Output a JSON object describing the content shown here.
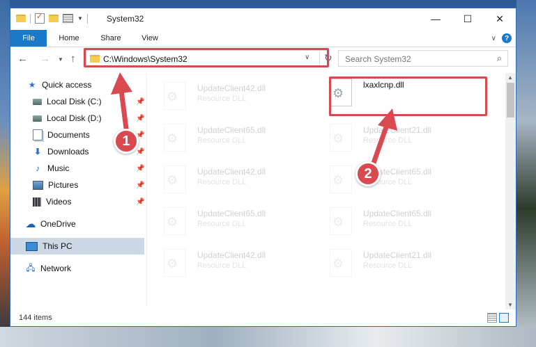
{
  "window": {
    "title": "System32",
    "controls": {
      "minimize": "—",
      "maximize": "☐",
      "close": "✕"
    }
  },
  "ribbon": {
    "tabs": {
      "file": "File",
      "home": "Home",
      "share": "Share",
      "view": "View"
    },
    "help": "?"
  },
  "navigation": {
    "address": "C:\\Windows\\System32",
    "search_placeholder": "Search System32"
  },
  "sidebar": {
    "items": [
      {
        "label": "Quick access",
        "icon": "star-icon",
        "pinned": false
      },
      {
        "label": "Local Disk (C:)",
        "icon": "drive-icon",
        "pinned": true
      },
      {
        "label": "Local Disk (D:)",
        "icon": "drive-icon",
        "pinned": true
      },
      {
        "label": "Documents",
        "icon": "documents-icon",
        "pinned": true
      },
      {
        "label": "Downloads",
        "icon": "download-icon",
        "pinned": true
      },
      {
        "label": "Music",
        "icon": "music-icon",
        "pinned": true
      },
      {
        "label": "Pictures",
        "icon": "pictures-icon",
        "pinned": true
      },
      {
        "label": "Videos",
        "icon": "videos-icon",
        "pinned": true
      },
      {
        "label": "OneDrive",
        "icon": "onedrive-icon",
        "pinned": false
      },
      {
        "label": "This PC",
        "icon": "pc-icon",
        "pinned": false,
        "selected": true
      },
      {
        "label": "Network",
        "icon": "network-icon",
        "pinned": false
      }
    ]
  },
  "files": [
    {
      "name": "UpdateClient42.dll",
      "type": "Resource DLL",
      "faded": true
    },
    {
      "name": "lxaxlcnp.dll",
      "type": "",
      "faded": false,
      "highlighted": true
    },
    {
      "name": "UpdateClient65.dll",
      "type": "Resource DLL",
      "faded": true
    },
    {
      "name": "UpdateClient21.dll",
      "type": "Resource DLL",
      "faded": true
    },
    {
      "name": "UpdateClient42.dll",
      "type": "Resource DLL",
      "faded": true
    },
    {
      "name": "UpdateClient65.dll",
      "type": "Resource DLL",
      "faded": true
    },
    {
      "name": "UpdateClient65.dll",
      "type": "Resource DLL",
      "faded": true
    },
    {
      "name": "UpdateClient65.dll",
      "type": "Resource DLL",
      "faded": true
    },
    {
      "name": "UpdateClient42.dll",
      "type": "Resource DLL",
      "faded": true
    },
    {
      "name": "UpdateClient21.dll",
      "type": "Resource DLL",
      "faded": true
    }
  ],
  "status": {
    "item_count": "144 items"
  },
  "annotations": {
    "step1": "1",
    "step2": "2",
    "accent_color": "#d84a4f"
  }
}
